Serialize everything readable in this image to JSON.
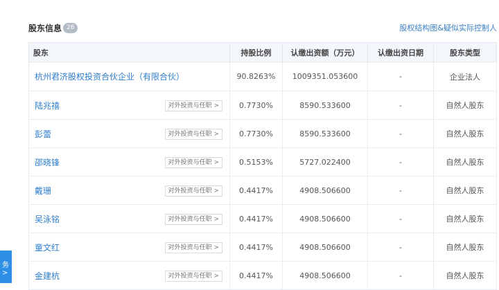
{
  "header": {
    "title": "股东信息",
    "count": "26",
    "link": "股权结构图&疑似实际控制人"
  },
  "table": {
    "columns": [
      "股东",
      "持股比例",
      "认缴出资额（万元）",
      "认缴出资日期",
      "股东类型"
    ],
    "rows": [
      {
        "name": "杭州君济股权投资合伙企业（有限合伙）",
        "ratio": "90.8263%",
        "amount": "1009351.053600",
        "date": "-",
        "type": "企业法人",
        "button": ""
      },
      {
        "name": "陆兆禧",
        "ratio": "0.7730%",
        "amount": "8590.533600",
        "date": "-",
        "type": "自然人股东",
        "button": "对外投资与任职 >"
      },
      {
        "name": "彭蕾",
        "ratio": "0.7730%",
        "amount": "8590.533600",
        "date": "-",
        "type": "自然人股东",
        "button": "对外投资与任职 >"
      },
      {
        "name": "邵晓锋",
        "ratio": "0.5153%",
        "amount": "5727.022400",
        "date": "-",
        "type": "自然人股东",
        "button": "对外投资与任职 >"
      },
      {
        "name": "戴珊",
        "ratio": "0.4417%",
        "amount": "4908.506600",
        "date": "-",
        "type": "自然人股东",
        "button": "对外投资与任职 >"
      },
      {
        "name": "吴泳铭",
        "ratio": "0.4417%",
        "amount": "4908.506600",
        "date": "-",
        "type": "自然人股东",
        "button": "对外投资与任职 >"
      },
      {
        "name": "童文红",
        "ratio": "0.4417%",
        "amount": "4908.506600",
        "date": "-",
        "type": "自然人股东",
        "button": "对外投资与任职 >"
      },
      {
        "name": "金建杭",
        "ratio": "0.4417%",
        "amount": "4908.506600",
        "date": "-",
        "type": "自然人股东",
        "button": "对外投资与任职 >"
      }
    ]
  },
  "side_tab": {
    "glyph": "务 >"
  }
}
